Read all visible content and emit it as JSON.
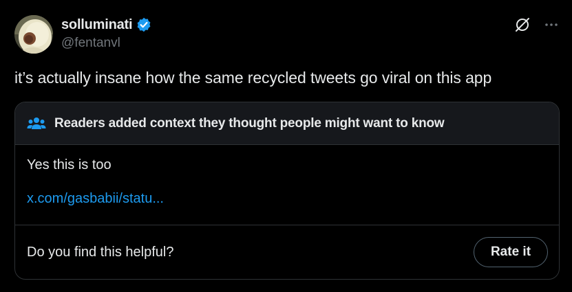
{
  "author": {
    "display_name": "solluminati",
    "handle": "@fentanvl",
    "verified": true,
    "avatar_icon": "hooded-figure-avatar"
  },
  "tweet": {
    "text": "it’s actually insane how the same recycled tweets go viral on this app"
  },
  "community_note": {
    "header": "Readers added context they thought people might want to know",
    "body": "Yes this is too",
    "link_text": "x.com/gasbabii/statu...",
    "prompt": "Do you find this helpful?",
    "rate_label": "Rate it"
  },
  "icons": {
    "verified": "verified-badge-icon",
    "grok": "grok-icon",
    "more": "more-icon",
    "readers": "readers-icon"
  },
  "colors": {
    "background": "#000000",
    "text": "#e7e9ea",
    "muted": "#71767b",
    "link": "#1d9bf0",
    "verified": "#1d9bf0",
    "border": "#2f3336",
    "note_header_bg": "#16181c",
    "readers_icon": "#1d9bf0"
  }
}
